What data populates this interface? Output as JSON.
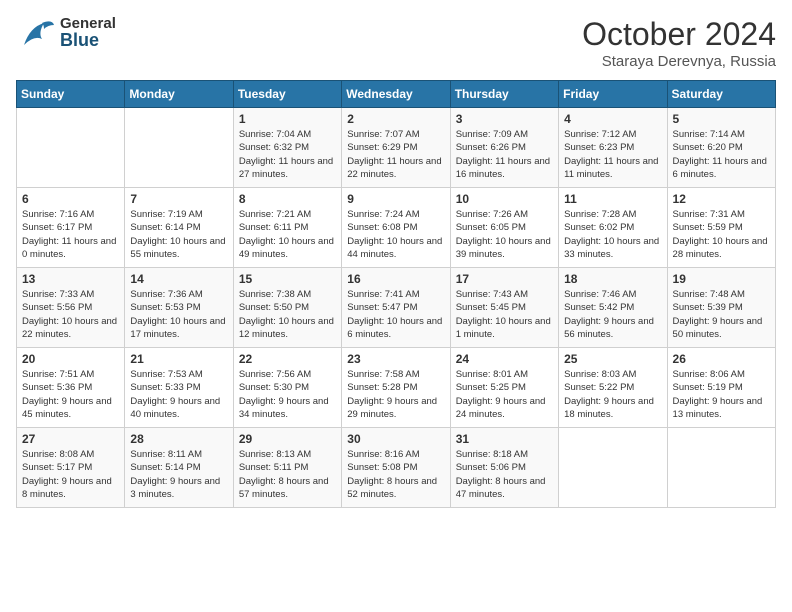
{
  "header": {
    "logo_general": "General",
    "logo_blue": "Blue",
    "month_title": "October 2024",
    "subtitle": "Staraya Derevnya, Russia"
  },
  "days_of_week": [
    "Sunday",
    "Monday",
    "Tuesday",
    "Wednesday",
    "Thursday",
    "Friday",
    "Saturday"
  ],
  "weeks": [
    [
      {
        "day": "",
        "sunrise": "",
        "sunset": "",
        "daylight": ""
      },
      {
        "day": "",
        "sunrise": "",
        "sunset": "",
        "daylight": ""
      },
      {
        "day": "1",
        "sunrise": "Sunrise: 7:04 AM",
        "sunset": "Sunset: 6:32 PM",
        "daylight": "Daylight: 11 hours and 27 minutes."
      },
      {
        "day": "2",
        "sunrise": "Sunrise: 7:07 AM",
        "sunset": "Sunset: 6:29 PM",
        "daylight": "Daylight: 11 hours and 22 minutes."
      },
      {
        "day": "3",
        "sunrise": "Sunrise: 7:09 AM",
        "sunset": "Sunset: 6:26 PM",
        "daylight": "Daylight: 11 hours and 16 minutes."
      },
      {
        "day": "4",
        "sunrise": "Sunrise: 7:12 AM",
        "sunset": "Sunset: 6:23 PM",
        "daylight": "Daylight: 11 hours and 11 minutes."
      },
      {
        "day": "5",
        "sunrise": "Sunrise: 7:14 AM",
        "sunset": "Sunset: 6:20 PM",
        "daylight": "Daylight: 11 hours and 6 minutes."
      }
    ],
    [
      {
        "day": "6",
        "sunrise": "Sunrise: 7:16 AM",
        "sunset": "Sunset: 6:17 PM",
        "daylight": "Daylight: 11 hours and 0 minutes."
      },
      {
        "day": "7",
        "sunrise": "Sunrise: 7:19 AM",
        "sunset": "Sunset: 6:14 PM",
        "daylight": "Daylight: 10 hours and 55 minutes."
      },
      {
        "day": "8",
        "sunrise": "Sunrise: 7:21 AM",
        "sunset": "Sunset: 6:11 PM",
        "daylight": "Daylight: 10 hours and 49 minutes."
      },
      {
        "day": "9",
        "sunrise": "Sunrise: 7:24 AM",
        "sunset": "Sunset: 6:08 PM",
        "daylight": "Daylight: 10 hours and 44 minutes."
      },
      {
        "day": "10",
        "sunrise": "Sunrise: 7:26 AM",
        "sunset": "Sunset: 6:05 PM",
        "daylight": "Daylight: 10 hours and 39 minutes."
      },
      {
        "day": "11",
        "sunrise": "Sunrise: 7:28 AM",
        "sunset": "Sunset: 6:02 PM",
        "daylight": "Daylight: 10 hours and 33 minutes."
      },
      {
        "day": "12",
        "sunrise": "Sunrise: 7:31 AM",
        "sunset": "Sunset: 5:59 PM",
        "daylight": "Daylight: 10 hours and 28 minutes."
      }
    ],
    [
      {
        "day": "13",
        "sunrise": "Sunrise: 7:33 AM",
        "sunset": "Sunset: 5:56 PM",
        "daylight": "Daylight: 10 hours and 22 minutes."
      },
      {
        "day": "14",
        "sunrise": "Sunrise: 7:36 AM",
        "sunset": "Sunset: 5:53 PM",
        "daylight": "Daylight: 10 hours and 17 minutes."
      },
      {
        "day": "15",
        "sunrise": "Sunrise: 7:38 AM",
        "sunset": "Sunset: 5:50 PM",
        "daylight": "Daylight: 10 hours and 12 minutes."
      },
      {
        "day": "16",
        "sunrise": "Sunrise: 7:41 AM",
        "sunset": "Sunset: 5:47 PM",
        "daylight": "Daylight: 10 hours and 6 minutes."
      },
      {
        "day": "17",
        "sunrise": "Sunrise: 7:43 AM",
        "sunset": "Sunset: 5:45 PM",
        "daylight": "Daylight: 10 hours and 1 minute."
      },
      {
        "day": "18",
        "sunrise": "Sunrise: 7:46 AM",
        "sunset": "Sunset: 5:42 PM",
        "daylight": "Daylight: 9 hours and 56 minutes."
      },
      {
        "day": "19",
        "sunrise": "Sunrise: 7:48 AM",
        "sunset": "Sunset: 5:39 PM",
        "daylight": "Daylight: 9 hours and 50 minutes."
      }
    ],
    [
      {
        "day": "20",
        "sunrise": "Sunrise: 7:51 AM",
        "sunset": "Sunset: 5:36 PM",
        "daylight": "Daylight: 9 hours and 45 minutes."
      },
      {
        "day": "21",
        "sunrise": "Sunrise: 7:53 AM",
        "sunset": "Sunset: 5:33 PM",
        "daylight": "Daylight: 9 hours and 40 minutes."
      },
      {
        "day": "22",
        "sunrise": "Sunrise: 7:56 AM",
        "sunset": "Sunset: 5:30 PM",
        "daylight": "Daylight: 9 hours and 34 minutes."
      },
      {
        "day": "23",
        "sunrise": "Sunrise: 7:58 AM",
        "sunset": "Sunset: 5:28 PM",
        "daylight": "Daylight: 9 hours and 29 minutes."
      },
      {
        "day": "24",
        "sunrise": "Sunrise: 8:01 AM",
        "sunset": "Sunset: 5:25 PM",
        "daylight": "Daylight: 9 hours and 24 minutes."
      },
      {
        "day": "25",
        "sunrise": "Sunrise: 8:03 AM",
        "sunset": "Sunset: 5:22 PM",
        "daylight": "Daylight: 9 hours and 18 minutes."
      },
      {
        "day": "26",
        "sunrise": "Sunrise: 8:06 AM",
        "sunset": "Sunset: 5:19 PM",
        "daylight": "Daylight: 9 hours and 13 minutes."
      }
    ],
    [
      {
        "day": "27",
        "sunrise": "Sunrise: 8:08 AM",
        "sunset": "Sunset: 5:17 PM",
        "daylight": "Daylight: 9 hours and 8 minutes."
      },
      {
        "day": "28",
        "sunrise": "Sunrise: 8:11 AM",
        "sunset": "Sunset: 5:14 PM",
        "daylight": "Daylight: 9 hours and 3 minutes."
      },
      {
        "day": "29",
        "sunrise": "Sunrise: 8:13 AM",
        "sunset": "Sunset: 5:11 PM",
        "daylight": "Daylight: 8 hours and 57 minutes."
      },
      {
        "day": "30",
        "sunrise": "Sunrise: 8:16 AM",
        "sunset": "Sunset: 5:08 PM",
        "daylight": "Daylight: 8 hours and 52 minutes."
      },
      {
        "day": "31",
        "sunrise": "Sunrise: 8:18 AM",
        "sunset": "Sunset: 5:06 PM",
        "daylight": "Daylight: 8 hours and 47 minutes."
      },
      {
        "day": "",
        "sunrise": "",
        "sunset": "",
        "daylight": ""
      },
      {
        "day": "",
        "sunrise": "",
        "sunset": "",
        "daylight": ""
      }
    ]
  ]
}
